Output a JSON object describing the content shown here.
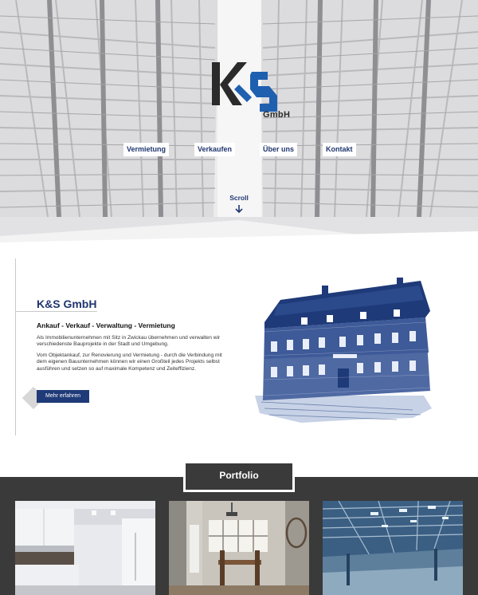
{
  "header": {
    "logo_text": "K&S",
    "logo_suffix": "GmbH",
    "nav": [
      "Vermietung",
      "Verkaufen",
      "Über uns",
      "Kontakt"
    ],
    "scroll_label": "Scroll"
  },
  "about": {
    "title": "K&S GmbH",
    "subtitle": "Ankauf - Verkauf - Verwaltung - Vermietung",
    "paragraph1": "Als Immobilienunternehmen mit Sitz in Zwickau übernehmen und verwalten wir verschiedenste Bauprojekte in der Stadt und Umgebung.",
    "paragraph2": "Vom Objektankauf, zur Renovierung und Vermietung - durch die Verbindung mit dem eigenen Bauunternehmen können wir einen Großteil jedes Projekts selbst ausführen und setzen so auf maximale Kompetenz und Zeiteffizienz.",
    "button_label": "Mehr erfahren"
  },
  "portfolio": {
    "title": "Portfolio",
    "tiles": [
      "kitchen-photo",
      "dining-room-photo",
      "warehouse-photo"
    ]
  },
  "colors": {
    "brand_blue": "#1f3a78",
    "dark": "#3a3a3a",
    "hero_bg": "#e9e9ea"
  }
}
